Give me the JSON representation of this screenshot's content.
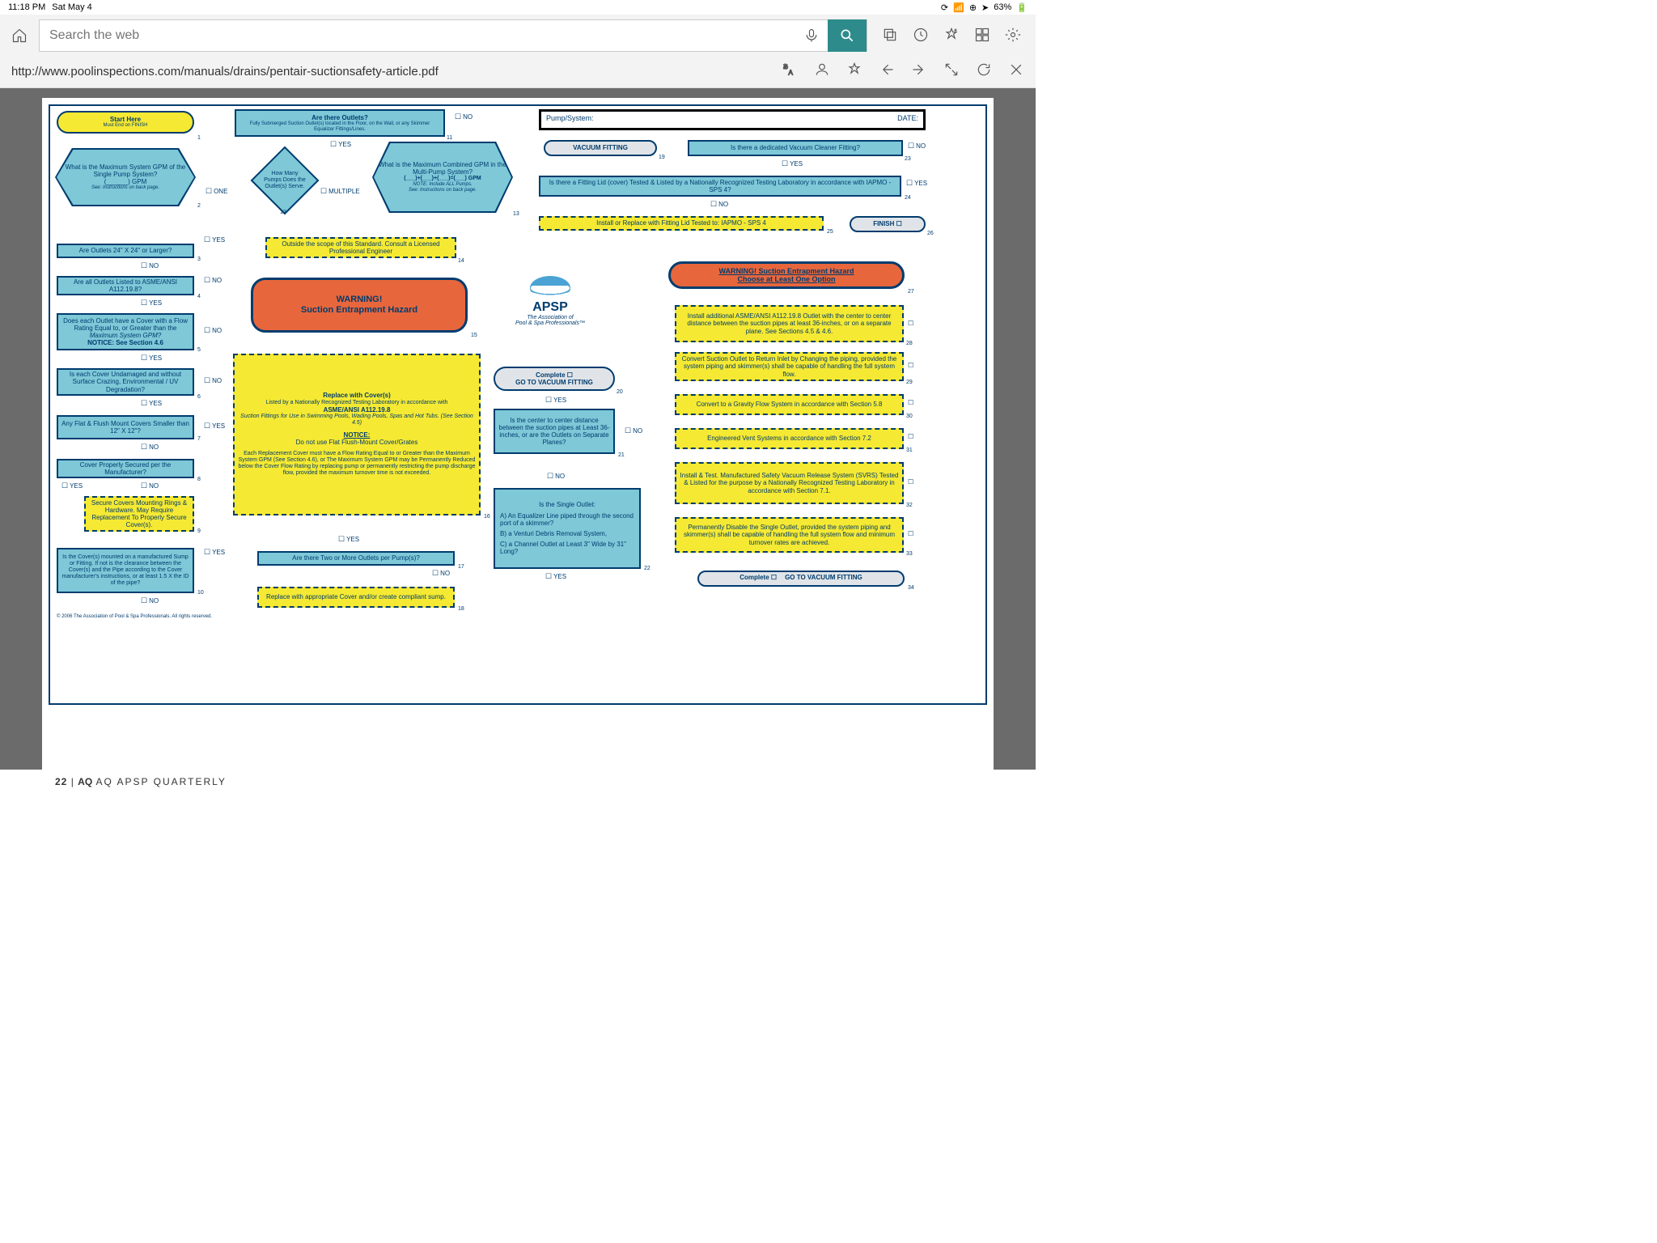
{
  "status": {
    "time": "11:18 PM",
    "date": "Sat May 4",
    "battery": "63%"
  },
  "browser": {
    "search_placeholder": "Search the web",
    "url": "http://www.poolinspections.com/manuals/drains/pentair-suctionsafety-article.pdf"
  },
  "page_footer": {
    "num": "22",
    "sep": "|",
    "mag": "AQ APSP QUARTERLY"
  },
  "header_form": {
    "pump": "Pump/System:",
    "date": "DATE:"
  },
  "apsp": {
    "name": "APSP",
    "sub1": "The Association of",
    "sub2": "Pool & Spa Professionals™"
  },
  "copyright": "© 2006 The Association of Pool & Spa Professionals. All rights reserved.",
  "start": {
    "title": "Start Here",
    "sub": "Must End on FINISH"
  },
  "b11": {
    "t": "Are there Outlets?",
    "s": "Fully Submerged Suction Outlet(s) located in the Floor, on the Wall, or any Skimmer Equalizer Fittings/Lines."
  },
  "b12_hex": {
    "t": "What is the Maximum System GPM of the Single Pump System?",
    "g": "(______) GPM",
    "s": "See: Instructions on back page."
  },
  "b12_dia": {
    "t": "How Many Pumps Does the Outlet(s) Serve."
  },
  "b13_hex": {
    "t": "What is the Maximum Combined GPM in the Multi-Pump System?",
    "g": "(___)+(___)+(___)=(___) GPM",
    "n": "NOTE: Include ALL Pumps.",
    "s": "See: Instructions on back page."
  },
  "b3": "Are Outlets 24\" X 24\" or Larger?",
  "b4": "Are all Outlets Listed to ASME/ANSI A112.19.8?",
  "b5": {
    "a": "Does each Outlet have a Cover with a Flow Rating Equal to, or Greater than the",
    "b": "Maximum System GPM?",
    "c": "NOTICE: See Section 4.6"
  },
  "b6": "Is each Cover Undamaged and without Surface Crazing, Environmental / UV Degradation?",
  "b7": "Any Flat & Flush Mount Covers Smaller than 12\" X 12\"?",
  "b8": "Cover Properly Secured per the Manufacturer?",
  "b9": "Secure Covers Mounting Rings & Hardware. May Require Replacement To Properly Secure Cover(s).",
  "b10": "Is the Cover(s) mounted on a manufactured Sump or Fitting. If not is the clearance between the Cover(s) and the Pipe according to the Cover manufacturer's instructions, or at least 1.5 X the ID of the pipe?",
  "b14": "Outside the scope of this Standard. Consult a Licensed Professional Engineer",
  "b15": {
    "t": "WARNING!",
    "s": "Suction Entrapment Hazard"
  },
  "b16": {
    "t": "Replace with Cover(s)",
    "l1": "Listed by a Nationally Recognized Testing Laboratory in accordance with",
    "l2": "ASME/ANSI A112.19.8",
    "l3": "Suction Fittings for Use in Swimming Pools, Wading Pools, Spas and Hot Tubs. (See Section 4.5)",
    "n": "NOTICE:",
    "l4": "Do not use Flat Flush-Mount Cover/Grates",
    "l5": "Each Replacement Cover must have a Flow Rating Equal to or Greater than the Maximum System GPM (See Section 4.6), or The Maximum System GPM may be Permanently Reduced below the Cover Flow Rating by replacing pump or permanently restricting the pump discharge flow, provided the maximum turnover time is not exceeded."
  },
  "b17": "Are there Two or More Outlets per Pump(s)?",
  "b18": "Replace with appropriate Cover and/or create compliant sump.",
  "b19": "VACUUM FITTING",
  "b20": {
    "t": "Complete ☐",
    "s": "GO TO VACUUM FITTING"
  },
  "b21": "Is the center to center distance between the suction pipes at Least 36-inches, or are the Outlets on Separate Planes?",
  "b22": {
    "t": "Is the Single Outlet:",
    "a": "A)  An Equalizer Line piped through the second port of a skimmer?",
    "b": "B) a Venturi Debris Removal System,",
    "c": "C)  a Channel Outlet at Least 3\" Wide by 31\" Long?"
  },
  "b23": "Is there a dedicated Vacuum Cleaner Fitting?",
  "b24": "Is there a Fitting Lid (cover) Tested & Listed by a Nationally Recognized Testing Laboratory in accordance with IAPMO - SPS 4?",
  "b25": "Install or Replace with Fitting Lid Tested to: IAPMO - SPS 4",
  "b26": "FINISH ☐",
  "b27": {
    "t": "WARNING! Suction Entrapment Hazard",
    "s": "Choose at Least One Option"
  },
  "b28": "Install additional ASME/ANSI A112.19.8 Outlet with the center to center distance between the suction pipes at least 36-inches, or on a separate plane. See Sections 4.5 & 4.6.",
  "b29": "Convert Suction Outlet to Return Inlet by Changing the piping, provided the system piping and skimmer(s) shall be capable of handling the full system flow.",
  "b30": "Convert to a Gravity Flow System in accordance with Section 5.8",
  "b31": "Engineered Vent Systems in accordance with Section 7.2",
  "b32": "Install & Test. Manufactured Safety Vacuum Release System (SVRS) Tested & Listed for the purpose by a Nationally Recognized Testing Laboratory in accordance with Section 7.1.",
  "b33": "Permanently Disable the Single Outlet, provided the system piping and skimmer(s) shall be capable of handling the full system flow and minimum turnover rates are achieved.",
  "b34": {
    "t": "Complete ☐",
    "s": "GO TO VACUUM FITTING"
  },
  "labels": {
    "yes": "YES",
    "no": "NO",
    "one": "ONE",
    "multiple": "MULTIPLE"
  }
}
